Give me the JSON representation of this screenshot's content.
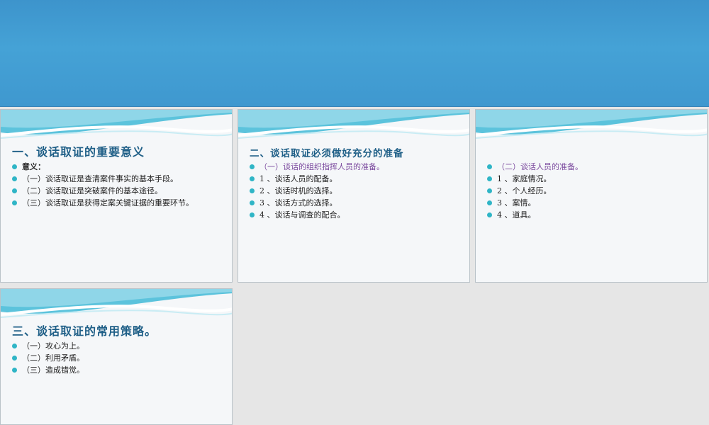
{
  "slides": [
    {
      "title": "一、谈话取证的重要意义",
      "items": [
        {
          "text": "意义："
        },
        {
          "text": "（一）谈话取证是查清案件事实的基本手段。"
        },
        {
          "text": "（二）谈话取证是突破案件的基本途径。"
        },
        {
          "text": "（三）谈话取证是获得定案关键证据的重要环节。"
        }
      ]
    },
    {
      "title": "二、谈话取证必须做好充分的准备",
      "items": [
        {
          "text": "（一）谈话的组织指挥人员的准备。"
        },
        {
          "text": "1 、谈话人员的配备。"
        },
        {
          "text": "2 、谈话时机的选择。"
        },
        {
          "text": "3 、谈话方式的选择。"
        },
        {
          "text": "4 、谈话与调查的配合。"
        }
      ]
    },
    {
      "title": "",
      "items": [
        {
          "text": "（二）谈话人员的准备。"
        },
        {
          "text": "1 、家庭情况。"
        },
        {
          "text": "2 、个人经历。"
        },
        {
          "text": "3 、案情。"
        },
        {
          "text": "4 、道具。"
        }
      ]
    },
    {
      "title": "三、谈话取证的常用策略。",
      "items": [
        {
          "text": "（一）攻心为上。"
        },
        {
          "text": "（二）利用矛盾。"
        },
        {
          "text": "（三）造成错觉。"
        }
      ]
    }
  ],
  "colors": {
    "banner": "#45a2d6",
    "title": "#1f5f87",
    "bullet": "#2fb5c6",
    "highlight": "#7b4a9e"
  }
}
